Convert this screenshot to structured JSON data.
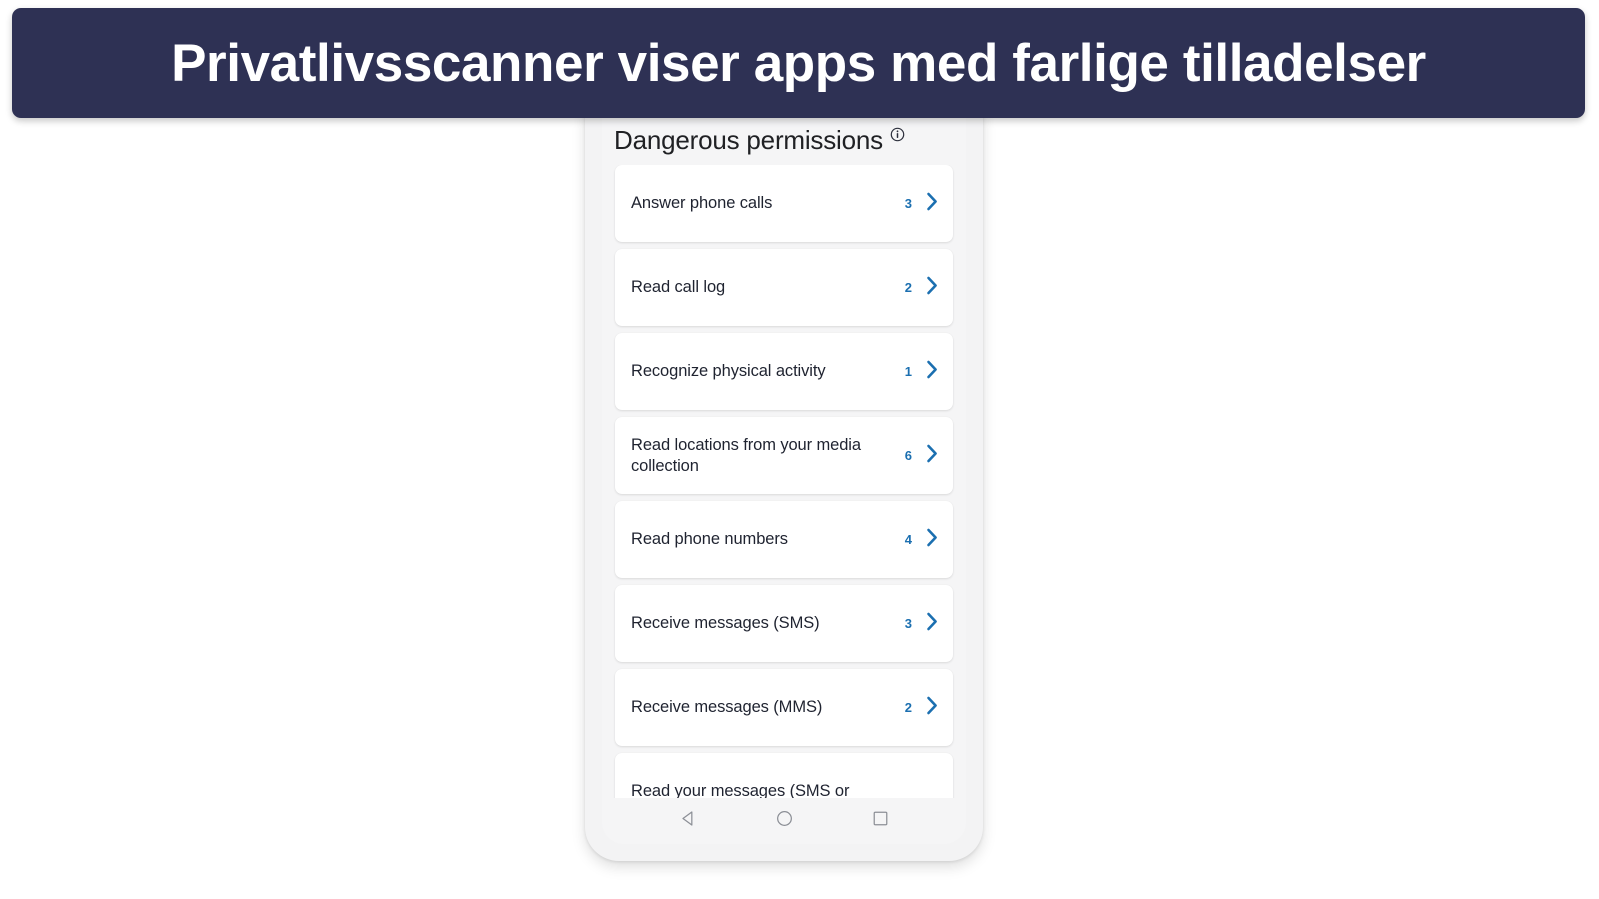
{
  "banner": {
    "text": "Privatlivsscanner viser apps med farlige tilladelser",
    "background_color": "#2e3154",
    "text_color": "#ffffff"
  },
  "phone": {
    "screen": {
      "background_color": "#f5f5f6",
      "header": {
        "title": "Dangerous permissions",
        "info_icon": "info-icon"
      },
      "permissions": [
        {
          "label": "Answer phone calls",
          "count": "3",
          "chevron": "chevron-right-icon"
        },
        {
          "label": "Read call log",
          "count": "2",
          "chevron": "chevron-right-icon"
        },
        {
          "label": "Recognize physical activity",
          "count": "1",
          "chevron": "chevron-right-icon"
        },
        {
          "label": "Read locations from your media collection",
          "count": "6",
          "chevron": "chevron-right-icon"
        },
        {
          "label": "Read phone numbers",
          "count": "4",
          "chevron": "chevron-right-icon"
        },
        {
          "label": "Receive messages (SMS)",
          "count": "3",
          "chevron": "chevron-right-icon"
        },
        {
          "label": "Receive messages (MMS)",
          "count": "2",
          "chevron": "chevron-right-icon"
        },
        {
          "label": "Read your messages (SMS or",
          "count": "",
          "chevron": "chevron-right-icon"
        }
      ],
      "accent_color": "#1b6fb0",
      "card_color": "#ffffff",
      "text_color": "#1f2330"
    },
    "nav_bar": {
      "back": "back-triangle-icon",
      "home": "home-circle-icon",
      "recents": "recents-square-icon",
      "icon_color": "#8c8f96"
    }
  }
}
